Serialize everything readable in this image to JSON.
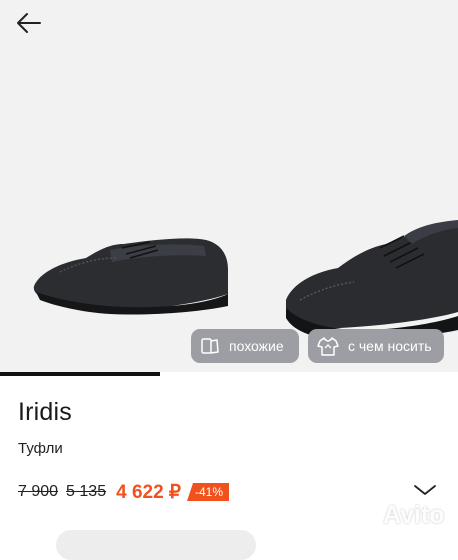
{
  "product": {
    "brand": "Iridis",
    "category": "Туфли"
  },
  "gallery": {
    "progress": 0.35,
    "chips": [
      {
        "label": "похожие",
        "icon": "similar-cards-icon"
      },
      {
        "label": "с чем носить",
        "icon": "shirt-hanger-icon"
      }
    ]
  },
  "price": {
    "old_price_1": "7 900",
    "old_price_2": "5 135",
    "current_price": "4 622 ₽",
    "discount": "-41%"
  },
  "colors": {
    "accent": "#f1521d",
    "chip_bg": "#9c9ea3",
    "gallery_bg": "#f2f2f2"
  },
  "watermark": "Avito"
}
